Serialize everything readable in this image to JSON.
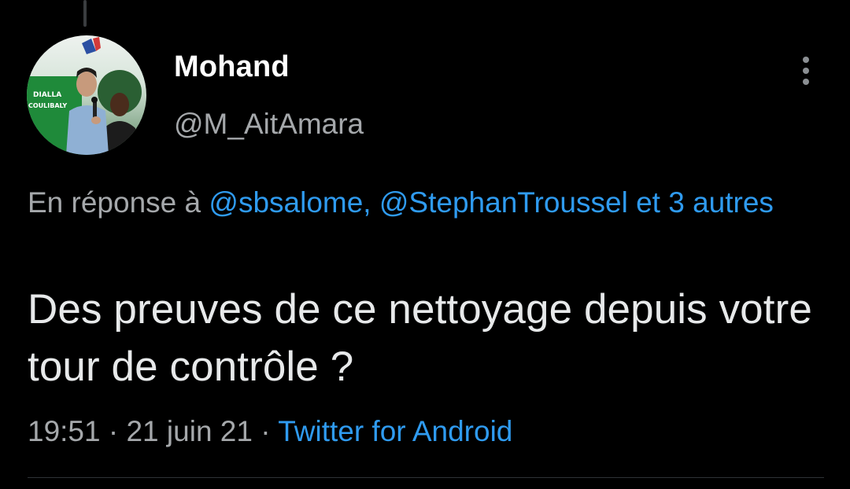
{
  "tweet": {
    "author": {
      "display_name": "Mohand",
      "handle": "@M_AitAmara",
      "avatar": {
        "description_icon": "profile-photo",
        "banner_text_line1": "DIALLA",
        "banner_text_line2": "COULIBALY"
      }
    },
    "more_icon": "vertical-dots-icon",
    "reply_context": {
      "prefix": "En réponse à",
      "mention_1": "@sbsalome,",
      "mention_2": "@StephanTroussel",
      "others": "et 3 autres"
    },
    "text": "Des preuves de ce nettoyage depuis votre tour de contrôle ?",
    "meta": {
      "time": "19:51",
      "separator_1": "·",
      "date": "21 juin 21",
      "separator_2": "·",
      "source": "Twitter for Android"
    }
  },
  "colors": {
    "background": "#000000",
    "primary_text": "#e7e9ea",
    "secondary_text": "#a5a8ab",
    "link": "#2f9bf0",
    "divider": "#2f3336"
  }
}
